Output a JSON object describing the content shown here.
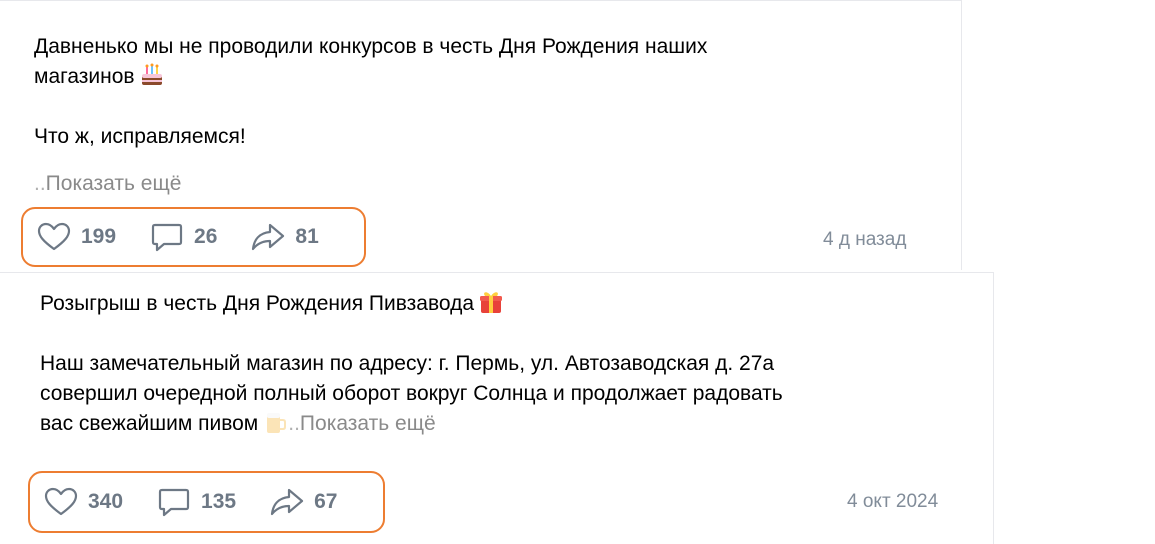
{
  "posts": [
    {
      "text_line1": "Давненько мы не проводили конкурсов в честь Дня Рождения наших",
      "text_line2": "магазинов",
      "text_line2_emoji": "cake-emoji",
      "text_line3": "Что ж, исправляемся!",
      "show_more_prefix": "..",
      "show_more": "Показать ещё",
      "likes": "199",
      "comments": "26",
      "shares": "81",
      "date": "4 д назад"
    },
    {
      "text_line1": "Розыгрыш в честь Дня Рождения Пивзавода",
      "text_line1_emoji": "gift-emoji",
      "text_line2": "Наш замечательный магазин по адресу: г. Пермь, ул. Автозаводская д. 27а",
      "text_line3": "совершил очередной полный оборот вокруг Солнца и продолжает радовать",
      "text_line4": "вас свежайшим пивом",
      "text_line4_emoji": "beer-emoji",
      "show_more_prefix": "..",
      "show_more": "Показать ещё",
      "likes": "340",
      "comments": "135",
      "shares": "67",
      "date": "4 окт 2024"
    }
  ],
  "colors": {
    "highlight_border": "#ed7d31",
    "action_gray": "#6d7885",
    "date_gray": "#818c99",
    "show_more_gray": "#8a8a8a"
  }
}
